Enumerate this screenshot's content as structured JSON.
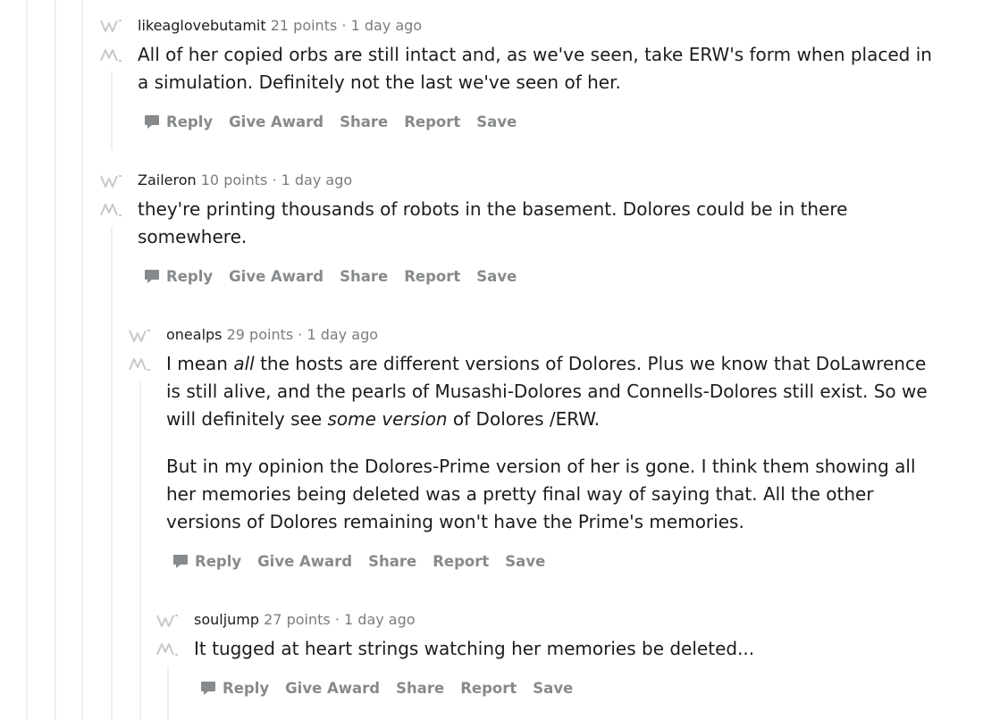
{
  "comments": [
    {
      "author": "likeaglovebutamit",
      "points": "21 points",
      "sep": "·",
      "time": "1 day ago",
      "paragraphs": [
        [
          {
            "text": "All of her copied orbs are still intact and, as we've seen, take ERW's form when placed in a simulation. Definitely not the last we've seen of her.",
            "italic": false
          }
        ]
      ]
    },
    {
      "author": "Zaileron",
      "points": "10 points",
      "sep": "·",
      "time": "1 day ago",
      "paragraphs": [
        [
          {
            "text": "they're printing thousands of robots in the basement. Dolores could be in there somewhere.",
            "italic": false
          }
        ]
      ]
    },
    {
      "author": "onealps",
      "points": "29 points",
      "sep": "·",
      "time": "1 day ago",
      "paragraphs": [
        [
          {
            "text": "I mean ",
            "italic": false
          },
          {
            "text": "all",
            "italic": true
          },
          {
            "text": " the hosts are different versions of Dolores. Plus we know that DoLawrence is still alive, and the pearls of Musashi-Dolores and Connells-Dolores still exist. So we will definitely see ",
            "italic": false
          },
          {
            "text": "some version",
            "italic": true
          },
          {
            "text": " of Dolores /ERW.",
            "italic": false
          }
        ],
        [
          {
            "text": "But in my opinion the Dolores-Prime version of her is gone. I think them showing all her memories being deleted was a pretty final way of saying that. All the other versions of Dolores remaining won't have the Prime's memories.",
            "italic": false
          }
        ]
      ]
    },
    {
      "author": "souljump",
      "points": "27 points",
      "sep": "·",
      "time": "1 day ago",
      "paragraphs": [
        [
          {
            "text": "It tugged at heart strings watching her memories be deleted...",
            "italic": false
          }
        ]
      ]
    }
  ],
  "actions": {
    "reply": "Reply",
    "give_award": "Give Award",
    "share": "Share",
    "report": "Report",
    "save": "Save"
  },
  "icons": {
    "upvote": "upvote-icon",
    "downvote": "downvote-icon",
    "reply": "speech-bubble-icon"
  },
  "colors": {
    "text": "#1c1c1c",
    "meta": "#7c7c7c",
    "action": "#878a8c",
    "thread_line": "#edeff1",
    "vote_arrow": "#c8c8c8"
  }
}
